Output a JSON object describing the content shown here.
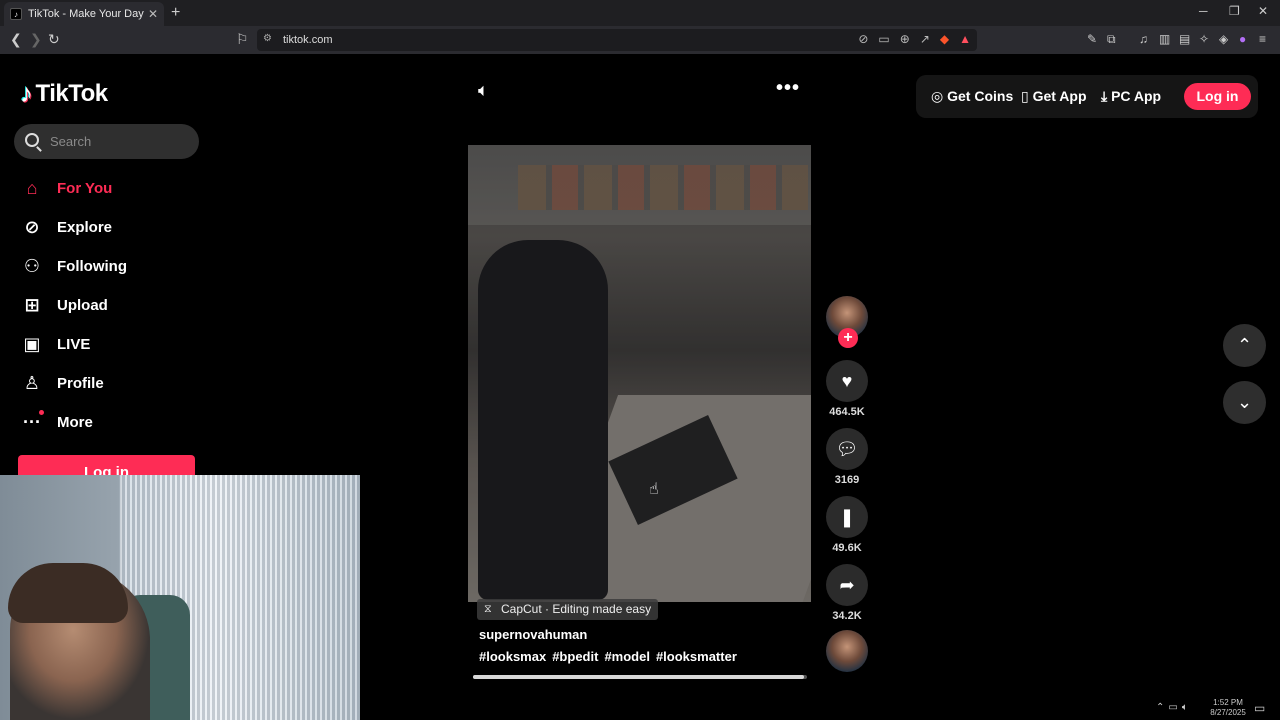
{
  "browser": {
    "tab_title": "TikTok - Make Your Day",
    "url": "tiktok.com"
  },
  "logo": {
    "text": "TikTok"
  },
  "search": {
    "placeholder": "Search"
  },
  "sidebar": {
    "items": [
      {
        "label": "For You",
        "icon": "home-icon",
        "active": true
      },
      {
        "label": "Explore",
        "icon": "compass-icon"
      },
      {
        "label": "Following",
        "icon": "following-icon"
      },
      {
        "label": "Upload",
        "icon": "upload-icon"
      },
      {
        "label": "LIVE",
        "icon": "live-icon"
      },
      {
        "label": "Profile",
        "icon": "profile-icon"
      },
      {
        "label": "More",
        "icon": "more-icon"
      }
    ],
    "login_label": "Log in"
  },
  "header": {
    "get_coins": "Get Coins",
    "get_app": "Get App",
    "pc_app": "PC App",
    "login": "Log in"
  },
  "video": {
    "capcut_label": "CapCut · Editing made easy",
    "author": "supernovahuman",
    "hashtags": [
      "#looksmax",
      "#bpedit",
      "#model",
      "#looksmatter"
    ],
    "progress": 0.99
  },
  "actions": {
    "likes": "464.5K",
    "comments": "3169",
    "saves": "49.6K",
    "shares": "34.2K"
  },
  "taskbar": {
    "time": "1:52 PM",
    "date": "8/27/2025"
  },
  "colors": {
    "accent": "#fe2c55"
  }
}
